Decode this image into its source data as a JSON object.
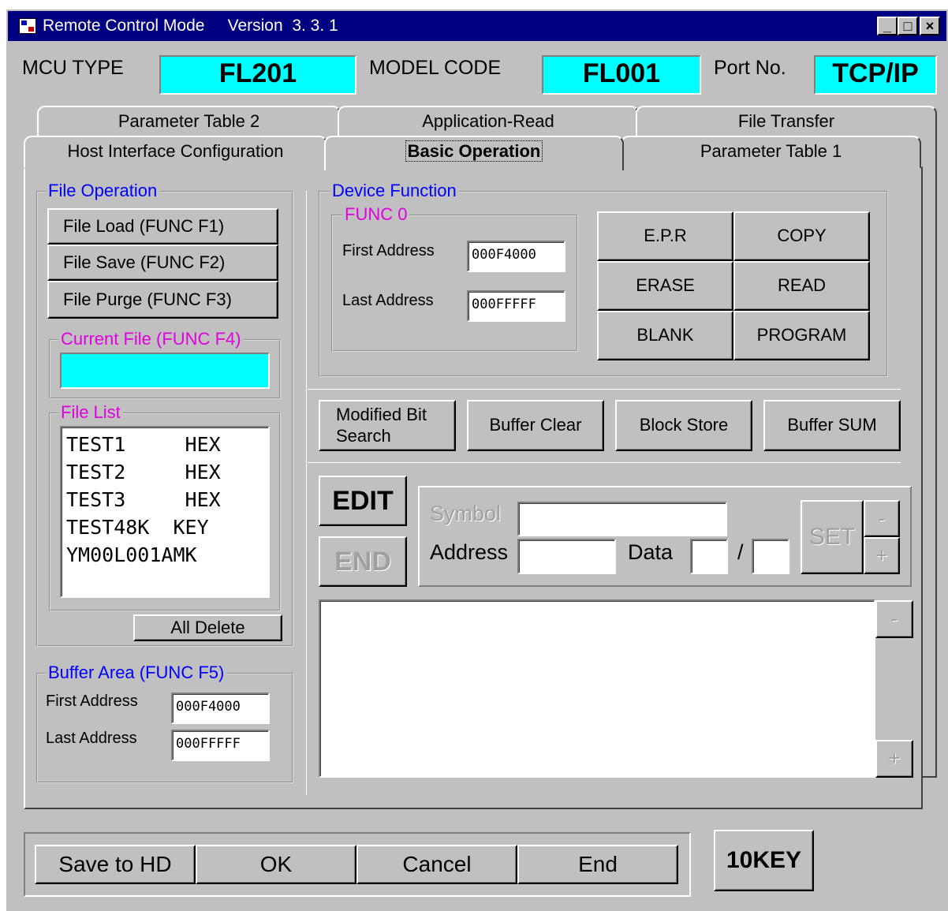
{
  "window": {
    "title": "Remote Control Mode",
    "version": "Version  3. 3. 1",
    "controls": {
      "minimize": "_",
      "maximize": "□",
      "close": "×"
    }
  },
  "header": {
    "mcu_type_label": "MCU TYPE",
    "mcu_type_value": "FL201",
    "model_code_label": "MODEL CODE",
    "model_code_value": "FL001",
    "port_label": "Port No.",
    "port_value": "TCP/IP"
  },
  "tabs": {
    "back_row": [
      "Parameter Table 2",
      "Application-Read",
      "File Transfer"
    ],
    "front_row": [
      "Host Interface Configuration",
      "Basic Operation",
      "Parameter Table 1"
    ],
    "active": "Basic Operation"
  },
  "file_operation": {
    "title": "File Operation",
    "buttons": [
      "File Load   (FUNC F1)",
      "File Save   (FUNC F2)",
      "File Purge (FUNC F3)"
    ]
  },
  "current_file": {
    "title": "Current File (FUNC F4)",
    "value": ""
  },
  "file_list": {
    "title": "File List",
    "items": [
      "TEST1     HEX",
      "TEST2     HEX",
      "TEST3     HEX",
      "TEST48K  KEY",
      "YM00L001AMK"
    ],
    "all_delete": "All Delete"
  },
  "buffer_area": {
    "title": "Buffer Area (FUNC F5)",
    "first_label": "First  Address",
    "first_value": "000F4000",
    "last_label": "Last  Address",
    "last_value": "000FFFFF"
  },
  "device_function": {
    "title": "Device Function",
    "func0": {
      "title": "FUNC 0",
      "first_label": "First  Address",
      "first_value": "000F4000",
      "last_label": "Last  Address",
      "last_value": "000FFFFF"
    },
    "buttons": [
      "E.P.R",
      "COPY",
      "ERASE",
      "READ",
      "BLANK",
      "PROGRAM"
    ]
  },
  "action_buttons": {
    "modified_bit": "Modified Bit Search",
    "buffer_clear": "Buffer Clear",
    "block_store": "Block Store",
    "buffer_sum": "Buffer SUM"
  },
  "edit": {
    "edit_label": "EDIT",
    "end_label": "END",
    "symbol_label": "Symbol",
    "symbol_value": "",
    "address_label": "Address",
    "address_value": "",
    "data_label": "Data",
    "data_value": "",
    "slash": "/",
    "data2_value": "",
    "set_label": "SET",
    "minus": "-",
    "plus": "+"
  },
  "output": {
    "text": "",
    "minus": "-",
    "plus": "+"
  },
  "footer": {
    "buttons": [
      "Save to HD",
      "OK",
      "Cancel",
      "End"
    ],
    "tenkey": "10KEY"
  }
}
